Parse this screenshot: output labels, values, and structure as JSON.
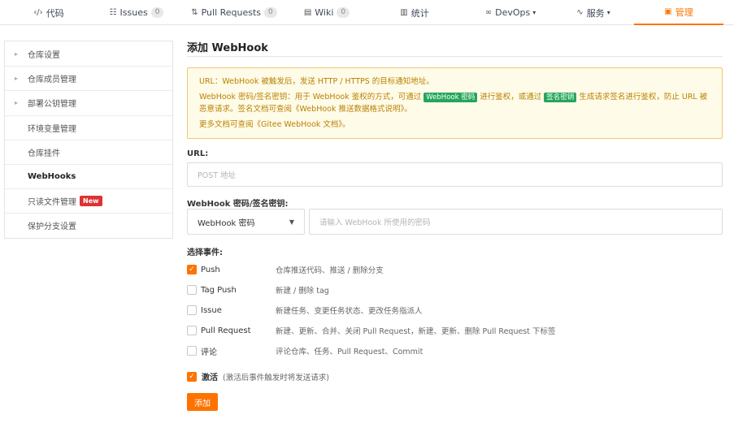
{
  "nav": {
    "tabs": [
      {
        "icon": "code-icon",
        "glyph": "‹/›",
        "label": "代码"
      },
      {
        "icon": "issues-icon",
        "glyph": "☷",
        "label": "Issues",
        "count": "0"
      },
      {
        "icon": "pull-request-icon",
        "glyph": "⇅",
        "label": "Pull Requests",
        "count": "0"
      },
      {
        "icon": "wiki-icon",
        "glyph": "▤",
        "label": "Wiki",
        "count": "0"
      },
      {
        "icon": "stats-icon",
        "glyph": "▥",
        "label": "统计"
      },
      {
        "icon": "devops-icon",
        "glyph": "∞",
        "label": "DevOps",
        "caret": "▾"
      },
      {
        "icon": "service-icon",
        "glyph": "∿",
        "label": "服务",
        "caret": "▾"
      },
      {
        "icon": "manage-icon",
        "glyph": "▣",
        "label": "管理"
      }
    ],
    "active_color": "#fe7300"
  },
  "sidebar": {
    "items": [
      {
        "label": "仓库设置"
      },
      {
        "label": "仓库成员管理"
      },
      {
        "label": "部署公钥管理"
      },
      {
        "label": "环境变量管理"
      },
      {
        "label": "仓库挂件"
      },
      {
        "label": "WebHooks"
      },
      {
        "label": "只读文件管理",
        "badge": "New"
      },
      {
        "label": "保护分支设置"
      }
    ]
  },
  "main": {
    "title": "添加 WebHook",
    "notice": {
      "line1": "URL：WebHook 被触发后，发送 HTTP / HTTPS 的目标通知地址。",
      "line2_a": "WebHook 密码/签名密钥：用于 WebHook 鉴权的方式，可通过",
      "tag1": "WebHook 密码",
      "line2_b": "进行鉴权，或通过",
      "tag2": "签名密钥",
      "line2_c": "生成请求签名进行鉴权，防止 URL 被恶意请求。签名文档可查阅《WebHook 推送数据格式说明》。",
      "line3": "更多文档可查阅《Gitee WebHook 文档》。"
    },
    "url_label": "URL:",
    "url_placeholder": "POST 地址",
    "secret_label": "WebHook 密码/签名密钥:",
    "secret_select": "WebHook 密码",
    "secret_placeholder": "请输入 WebHook 所使用的密码",
    "events_label": "选择事件:",
    "events": [
      {
        "name": "Push",
        "desc": "仓库推送代码、推送 / 删除分支",
        "checked": true
      },
      {
        "name": "Tag Push",
        "desc": "新建 / 删除 tag",
        "checked": false
      },
      {
        "name": "Issue",
        "desc": "新建任务、变更任务状态、更改任务指派人",
        "checked": false
      },
      {
        "name": "Pull Request",
        "desc": "新建、更新、合并、关闭 Pull Request，新建、更新、删除 Pull Request 下标签",
        "checked": false
      },
      {
        "name": "评论",
        "desc": "评论仓库、任务、Pull Request、Commit",
        "checked": false
      }
    ],
    "activate_label": "激活",
    "activate_desc": "(激活后事件触发时将发送请求)",
    "activate_checked": true,
    "add_button": "添加"
  }
}
